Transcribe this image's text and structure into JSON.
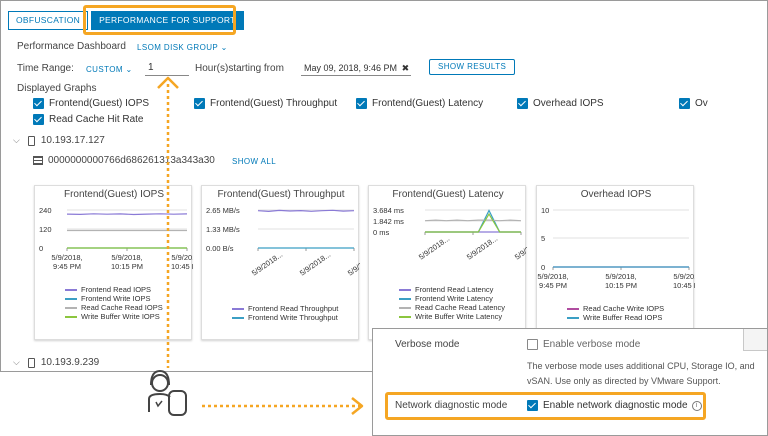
{
  "tabs": [
    {
      "label": "OBFUSCATION"
    },
    {
      "label": "PERFORMANCE FOR SUPPORT"
    }
  ],
  "dashboard": {
    "label": "Performance Dashboard",
    "selector": "LSOM DISK GROUP ⌄"
  },
  "time_range": {
    "label": "Time Range:",
    "mode": "CUSTOM ⌄",
    "hours_value": "1",
    "hours_label": "Hour(s)starting from",
    "start": "May 09, 2018, 9:46 PM",
    "show_results": "SHOW RESULTS"
  },
  "displayed_graphs": {
    "label": "Displayed Graphs",
    "items": [
      {
        "label": "Frontend(Guest) IOPS",
        "checked": true
      },
      {
        "label": "Frontend(Guest) Throughput",
        "checked": true
      },
      {
        "label": "Frontend(Guest) Latency",
        "checked": true
      },
      {
        "label": "Overhead IOPS",
        "checked": true
      },
      {
        "label": "Ov",
        "checked": true
      },
      {
        "label": "Read Cache Hit Rate",
        "checked": true
      }
    ]
  },
  "hosts": [
    {
      "ip": "10.193.17.127",
      "disk_group": "0000000000766d686261313a343a30",
      "show_all": "SHOW ALL"
    },
    {
      "ip": "10.193.9.239"
    }
  ],
  "colors": {
    "accent": "#0079b8",
    "highlight": "#f5a623",
    "frontend_read": "#8a7ad6",
    "frontend_write": "#3b9fc4",
    "read_cache": "#b3b3b3",
    "write_buffer": "#8cc63f"
  },
  "chart_data": [
    {
      "type": "line",
      "title": "Frontend(Guest) IOPS",
      "y_ticks": [
        "240",
        "120",
        "0"
      ],
      "x_ticks": [
        [
          "5/9/2018,",
          "9:45 PM"
        ],
        [
          "5/9/2018,",
          "10:15 PM"
        ],
        [
          "5/9/2018,",
          "10:45 PM"
        ]
      ],
      "ylim": [
        0,
        260
      ],
      "series": [
        {
          "name": "Frontend Read IOPS",
          "color": "#8a7ad6",
          "values": [
            232,
            230,
            234,
            231,
            233,
            229,
            232,
            234,
            231,
            233
          ]
        },
        {
          "name": "Frontend Write IOPS",
          "color": "#3b9fc4",
          "values": [
            0,
            0,
            0,
            0,
            0,
            0,
            0,
            0,
            0,
            0
          ]
        },
        {
          "name": "Read Cache Read IOPS",
          "color": "#b3b3b3",
          "values": [
            120,
            120,
            120,
            120,
            120,
            120,
            120,
            120,
            120,
            120
          ]
        },
        {
          "name": "Write Buffer Write IOPS",
          "color": "#8cc63f",
          "values": [
            0,
            0,
            0,
            0,
            0,
            0,
            0,
            0,
            0,
            0
          ]
        }
      ]
    },
    {
      "type": "line",
      "title": "Frontend(Guest) Throughput",
      "y_ticks": [
        "2.65 MB/s",
        "1.33 MB/s",
        "0.00 B/s"
      ],
      "x_ticks": [
        [
          "5/9/2018..."
        ],
        [
          "5/9/2018..."
        ],
        [
          "5/9/2018..."
        ]
      ],
      "ylim": [
        0,
        2.65
      ],
      "series": [
        {
          "name": "Frontend Read Throughput",
          "color": "#8a7ad6",
          "values": [
            2.6,
            2.55,
            2.62,
            2.58,
            2.61,
            2.56,
            2.6,
            2.63,
            2.57,
            2.6
          ]
        },
        {
          "name": "Frontend Write Throughput",
          "color": "#3b9fc4",
          "values": [
            0,
            0,
            0,
            0,
            0,
            0,
            0,
            0,
            0,
            0
          ]
        }
      ]
    },
    {
      "type": "line",
      "title": "Frontend(Guest) Latency",
      "y_ticks": [
        "3.684 ms",
        "1.842 ms",
        "0 ms"
      ],
      "x_ticks": [
        [
          "5/9/2018..."
        ],
        [
          "5/9/2018..."
        ],
        [
          "5/9/2018..."
        ]
      ],
      "ylim": [
        0,
        3.684
      ],
      "series": [
        {
          "name": "Frontend Read Latency",
          "color": "#8a7ad6",
          "values": [
            0,
            0,
            0,
            0,
            0,
            0,
            0,
            0,
            0,
            0
          ]
        },
        {
          "name": "Frontend Write Latency",
          "color": "#3b9fc4",
          "values": [
            0,
            0,
            0,
            0,
            0,
            0,
            3.6,
            0,
            0,
            0
          ]
        },
        {
          "name": "Read Cache Read Latency",
          "color": "#b3b3b3",
          "values": [
            1.9,
            2.0,
            1.9,
            2.0,
            1.9,
            2.0,
            2.0,
            1.9,
            2.0,
            1.9
          ]
        },
        {
          "name": "Write Buffer Write Latency",
          "color": "#8cc63f",
          "values": [
            0,
            0,
            0,
            0,
            0,
            0,
            3.0,
            0,
            0,
            0
          ]
        }
      ]
    },
    {
      "type": "line",
      "title": "Overhead IOPS",
      "y_ticks": [
        "10",
        "5",
        "0"
      ],
      "x_ticks": [
        [
          "5/9/2018,",
          "9:45 PM"
        ],
        [
          "5/9/2018,",
          "10:15 PM"
        ],
        [
          "5/9/2018,",
          "10:45 PM"
        ]
      ],
      "ylim": [
        0,
        10
      ],
      "series": [
        {
          "name": "Read Cache Write IOPS",
          "color": "#b04da0",
          "values": [
            0,
            0,
            0,
            0,
            0,
            0,
            0,
            0,
            0,
            0
          ]
        },
        {
          "name": "Write Buffer Read IOPS",
          "color": "#3b9fc4",
          "values": [
            0,
            0,
            0,
            0,
            0,
            0,
            0,
            0,
            0,
            0
          ]
        }
      ]
    }
  ],
  "settings": {
    "verbose": {
      "label": "Verbose mode",
      "checkbox": "Enable verbose mode",
      "checked": false,
      "desc1": "The verbose mode uses additional CPU, Storage IO, and",
      "desc2": "vSAN. Use only as directed by VMware Support."
    },
    "network": {
      "label": "Network diagnostic mode",
      "checkbox": "Enable network diagnostic mode",
      "checked": true,
      "info_icon": "info-icon"
    }
  }
}
